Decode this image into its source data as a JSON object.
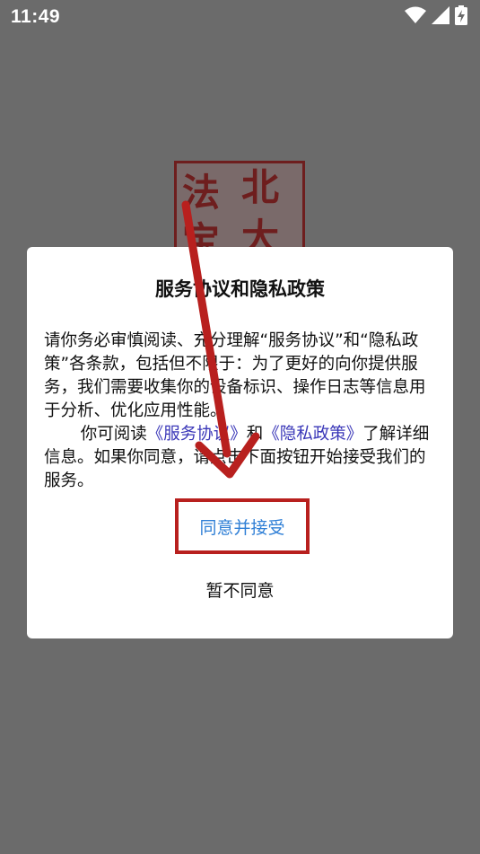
{
  "status_bar": {
    "time": "11:49",
    "icons": [
      "wifi-icon",
      "signal-icon",
      "battery-charging-icon"
    ]
  },
  "background": {
    "seal_chars": [
      "法",
      "北",
      "宝",
      "大"
    ],
    "seal_color": "#6e1e1e"
  },
  "dialog": {
    "title": "服务协议和隐私政策",
    "paragraph1": "请你务必审慎阅读、充分理解“服务协议”和“隐私政策”各条款，包括但不限于：为了更好的向你提供服务，我们需要收集你的设备标识、操作日志等信息用于分析、优化应用性能。",
    "paragraph2_prefix": "你可阅读",
    "link_service": "《服务协议》",
    "paragraph2_and": "和",
    "link_privacy": "《隐私政策》",
    "paragraph2_suffix": "了解详细信息。如果你同意，请点击下面按钮开始接受我们的服务。",
    "accept_label": "同意并接受",
    "decline_label": "暂不同意"
  },
  "colors": {
    "overlay": "#6b6b6b",
    "link": "#3a37b8",
    "accept": "#2f7fd6",
    "highlight": "#b8201e"
  }
}
